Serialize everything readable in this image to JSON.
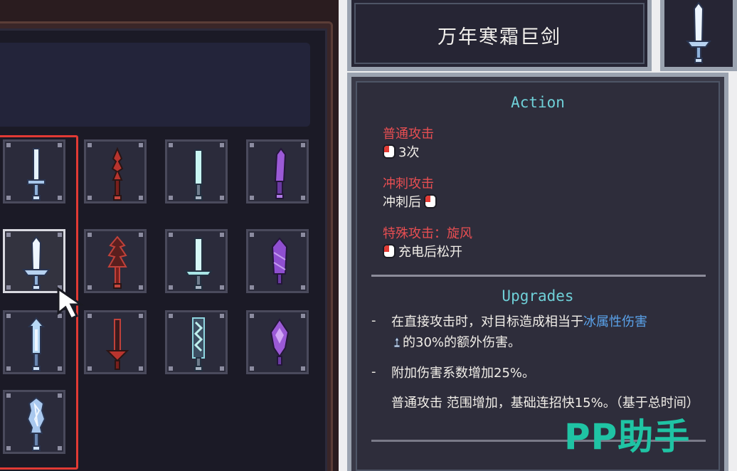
{
  "item": {
    "name": "万年寒霜巨剑",
    "icon": "ice-sword-icon"
  },
  "inventory": {
    "slots": [
      {
        "row": 0,
        "col": 0,
        "icon": "ice-sword-icon",
        "color": "#cfe8ff"
      },
      {
        "row": 0,
        "col": 1,
        "icon": "red-spike-sword-icon",
        "color": "#b8342e"
      },
      {
        "row": 0,
        "col": 2,
        "icon": "cyan-blade-icon",
        "color": "#bff0ee"
      },
      {
        "row": 0,
        "col": 3,
        "icon": "purple-blade-icon",
        "color": "#9b5ad6"
      },
      {
        "row": 1,
        "col": 0,
        "icon": "ice-greatsword-icon",
        "color": "#dfeffc",
        "selected": true
      },
      {
        "row": 1,
        "col": 1,
        "icon": "red-flame-sword-icon",
        "color": "#c0413a"
      },
      {
        "row": 1,
        "col": 2,
        "icon": "cyan-greatsword-icon",
        "color": "#bff0ee"
      },
      {
        "row": 1,
        "col": 3,
        "icon": "purple-crystal-sword-icon",
        "color": "#9b5ad6"
      },
      {
        "row": 2,
        "col": 0,
        "icon": "ice-arrow-sword-icon",
        "color": "#b7d8f5"
      },
      {
        "row": 2,
        "col": 1,
        "icon": "red-arrow-sword-icon",
        "color": "#b8342e"
      },
      {
        "row": 2,
        "col": 2,
        "icon": "cyan-zigzag-sword-icon",
        "color": "#8fd6e0"
      },
      {
        "row": 2,
        "col": 3,
        "icon": "purple-gem-sword-icon",
        "color": "#9b5ad6"
      },
      {
        "row": 3,
        "col": 0,
        "icon": "ice-crystal-sword-icon",
        "color": "#a9c8ee"
      }
    ]
  },
  "action": {
    "title": "Action",
    "items": [
      {
        "name": "普通攻击",
        "mouse_icon": "left-mouse-icon",
        "desc": "3次",
        "icon_first": true
      },
      {
        "name": "冲刺攻击",
        "mouse_icon": "left-mouse-icon",
        "desc": "冲刺后",
        "icon_first": false
      },
      {
        "name": "特殊攻击：旋风",
        "mouse_icon": "left-mouse-icon",
        "desc": "充电后松开",
        "icon_first": true
      }
    ]
  },
  "upgrades": {
    "title": "Upgrades",
    "dash": "-",
    "u1": {
      "text_a": "在直接攻击时，对目标造成相当于",
      "highlight": "冰属性伤害",
      "icon": "frost-icon",
      "text_b": "的30%的额外伤害。"
    },
    "u2": "附加伤害系数增加25%。",
    "u3": "普通攻击 范围增加，基础连招快15%。（基于总时间）"
  },
  "watermark": "PP助手",
  "colors": {
    "action_name": "#e84e52",
    "section_title": "#6fd0d8",
    "highlight": "#5aa2ea",
    "selection_frame": "#e23a34",
    "watermark": "#1fc4a4"
  }
}
